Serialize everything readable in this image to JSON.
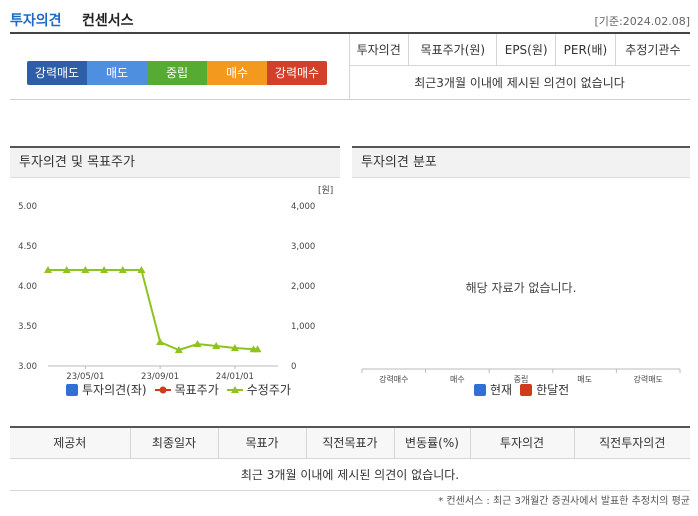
{
  "header": {
    "title_part1": "투자의견",
    "title_part2": "컨센서스",
    "base_date": "[기준:2024.02.08]"
  },
  "consensus": {
    "gauge": [
      {
        "label": "강력매도",
        "color": "#2f5ea8"
      },
      {
        "label": "매도",
        "color": "#4f8fe0"
      },
      {
        "label": "중립",
        "color": "#56ac32"
      },
      {
        "label": "매수",
        "color": "#f39a1e"
      },
      {
        "label": "강력매수",
        "color": "#d43f2a"
      }
    ],
    "columns": [
      "투자의견",
      "목표주가(원)",
      "EPS(원)",
      "PER(배)",
      "추정기관수"
    ],
    "empty_message": "최근3개월 이내에 제시된 의견이 없습니다"
  },
  "opinion_chart": {
    "title": "투자의견 및 목표주가",
    "unit": "[원]",
    "legend": [
      {
        "label": "투자의견(좌)",
        "color": "#2f6fd6"
      },
      {
        "label": "목표주가",
        "color": "#d23a1e"
      },
      {
        "label": "수정주가",
        "color": "#8fc31f"
      }
    ]
  },
  "distribution_chart": {
    "title": "투자의견 분포",
    "empty_message": "해당 자료가 없습니다.",
    "legend": [
      {
        "label": "현재",
        "color": "#2f6fd6"
      },
      {
        "label": "한달전",
        "color": "#d23a1e"
      }
    ]
  },
  "chart_data": [
    {
      "type": "line",
      "title": "",
      "x": [
        "23/03",
        "23/04",
        "23/05",
        "23/06",
        "23/07",
        "23/08",
        "23/09",
        "23/10",
        "23/11",
        "23/12",
        "24/01",
        "24/02",
        "24/02"
      ],
      "x_tick_labels": [
        "23/05/01",
        "23/09/01",
        "24/01/01"
      ],
      "y_left": {
        "ticks": [
          "5.00",
          "4.50",
          "4.00",
          "3.50",
          "3.00"
        ],
        "ylim": [
          3.0,
          5.0
        ]
      },
      "y_right": {
        "ticks": [
          "4,000",
          "3,000",
          "2,000",
          "1,000",
          "0"
        ],
        "ylim": [
          0,
          4000
        ]
      },
      "series": [
        {
          "name": "수정주가",
          "axis": "right",
          "color": "#8fc31f",
          "values": [
            2400,
            2400,
            2400,
            2400,
            2400,
            2400,
            600,
            400,
            550,
            500,
            450,
            420,
            420
          ]
        }
      ],
      "grid": false
    },
    {
      "type": "bar",
      "title": "",
      "categories": [
        "강력매수",
        "매수",
        "중립",
        "매도",
        "강력매도"
      ],
      "series": [
        {
          "name": "현재",
          "values": []
        },
        {
          "name": "한달전",
          "values": []
        }
      ]
    }
  ],
  "bottom_table": {
    "columns": [
      "제공처",
      "최종일자",
      "목표가",
      "직전목표가",
      "변동률(%)",
      "투자의견",
      "직전투자의견"
    ],
    "empty_message": "최근 3개월 이내에 제시된 의견이 없습니다."
  },
  "footnote": "* 컨센서스 : 최근 3개월간 증권사에서 발표한 추정치의 평균"
}
